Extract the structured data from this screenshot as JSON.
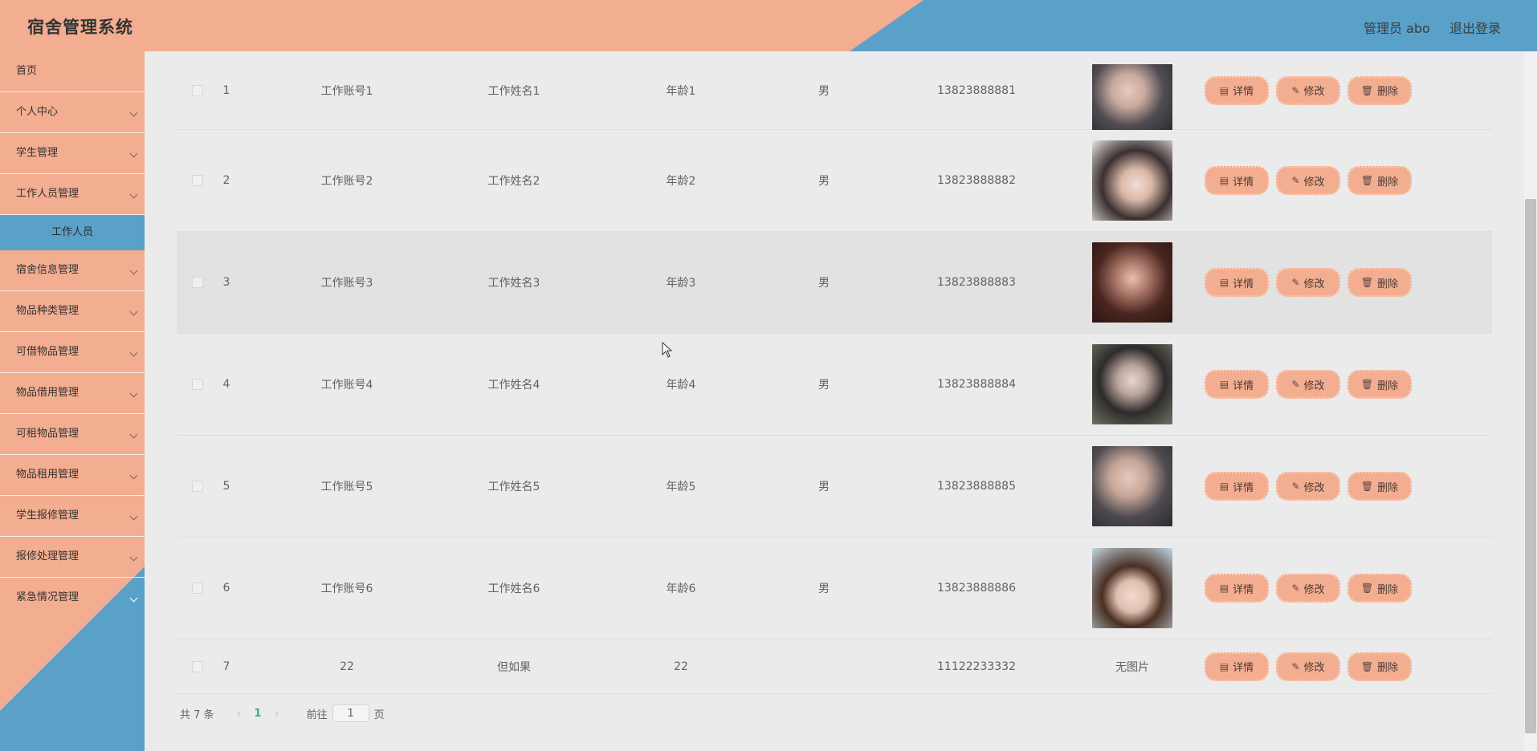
{
  "header": {
    "title": "宿舍管理系统",
    "user": "管理员 abo",
    "logout": "退出登录"
  },
  "sidebar": {
    "items": [
      {
        "label": "首页"
      },
      {
        "label": "个人中心"
      },
      {
        "label": "学生管理"
      },
      {
        "label": "工作人员管理"
      },
      {
        "label": "宿舍信息管理"
      },
      {
        "label": "物品种类管理"
      },
      {
        "label": "可借物品管理"
      },
      {
        "label": "物品借用管理"
      },
      {
        "label": "可租物品管理"
      },
      {
        "label": "物品租用管理"
      },
      {
        "label": "学生报修管理"
      },
      {
        "label": "报修处理管理"
      },
      {
        "label": "紧急情况管理"
      }
    ],
    "active_sub": "工作人员"
  },
  "table": {
    "rows": [
      {
        "index": "1",
        "account": "工作账号1",
        "name": "工作姓名1",
        "age": "年龄1",
        "sex": "男",
        "phone": "13823888881",
        "photo": "photo-1"
      },
      {
        "index": "2",
        "account": "工作账号2",
        "name": "工作姓名2",
        "age": "年龄2",
        "sex": "男",
        "phone": "13823888882",
        "photo": "photo-2"
      },
      {
        "index": "3",
        "account": "工作账号3",
        "name": "工作姓名3",
        "age": "年龄3",
        "sex": "男",
        "phone": "13823888883",
        "photo": "photo-3"
      },
      {
        "index": "4",
        "account": "工作账号4",
        "name": "工作姓名4",
        "age": "年龄4",
        "sex": "男",
        "phone": "13823888884",
        "photo": "photo-4"
      },
      {
        "index": "5",
        "account": "工作账号5",
        "name": "工作姓名5",
        "age": "年龄5",
        "sex": "男",
        "phone": "13823888885",
        "photo": "photo-5"
      },
      {
        "index": "6",
        "account": "工作账号6",
        "name": "工作姓名6",
        "age": "年龄6",
        "sex": "男",
        "phone": "13823888886",
        "photo": "photo-6"
      },
      {
        "index": "7",
        "account": "22",
        "name": "但如果",
        "age": "22",
        "sex": "",
        "phone": "11122233332",
        "photo_text": "无图片"
      }
    ],
    "actions": {
      "detail": "详情",
      "edit": "修改",
      "delete": "删除"
    }
  },
  "pagination": {
    "total": "共 7 条",
    "current_page": "1",
    "goto_label": "前往",
    "page_input": "1",
    "page_unit": "页"
  },
  "icons": {
    "detail": "document-icon",
    "edit": "pencil-icon",
    "delete": "trash-icon"
  }
}
